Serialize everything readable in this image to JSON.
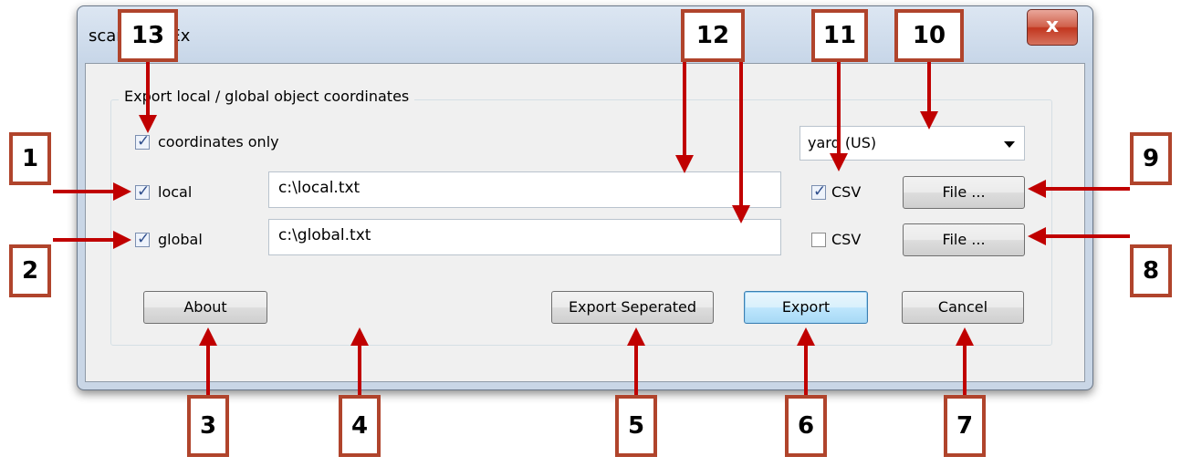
{
  "window": {
    "title": "scan CoorEx",
    "close_label": "x"
  },
  "group": {
    "legend": "Export local / global object coordinates"
  },
  "coordinates_only": {
    "label": "coordinates only",
    "checked": true
  },
  "unit_select": {
    "value": "yard (US)"
  },
  "local_row": {
    "label": "local",
    "checked": true,
    "path": "c:\\local.txt",
    "csv_label": "CSV",
    "csv_checked": true,
    "file_button": "File ..."
  },
  "global_row": {
    "label": "global",
    "checked": true,
    "path": "c:\\global.txt",
    "csv_label": "CSV",
    "csv_checked": false,
    "file_button": "File ..."
  },
  "buttons": {
    "about": "About",
    "export_separated": "Export Seperated",
    "export": "Export",
    "cancel": "Cancel"
  },
  "callouts": [
    "1",
    "2",
    "3",
    "4",
    "5",
    "6",
    "7",
    "8",
    "9",
    "10",
    "11",
    "12",
    "13"
  ],
  "colors": {
    "callout_border": "#b0442c",
    "arrow": "#c00000",
    "default_button": "#3c7fb1"
  }
}
